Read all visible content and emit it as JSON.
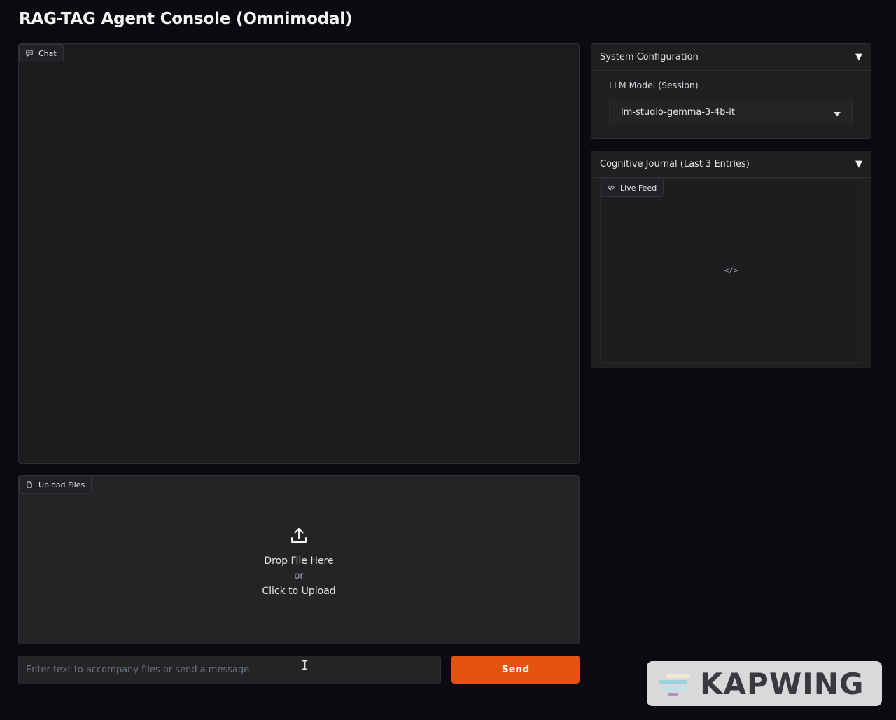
{
  "app": {
    "title": "RAG-TAG Agent Console (Omnimodal)"
  },
  "chat": {
    "label": "Chat",
    "icon": "chat-icon"
  },
  "upload": {
    "label": "Upload Files",
    "icon": "file-icon",
    "drop_text": "Drop File Here",
    "or_text": "- or -",
    "click_text": "Click to Upload",
    "upload_icon": "upload-icon"
  },
  "message": {
    "placeholder": "Enter text to accompany files or send a message",
    "value": ""
  },
  "send": {
    "label": "Send",
    "color": "#e4530f"
  },
  "system_config": {
    "title": "System Configuration",
    "caret": "▼",
    "llm_label": "LLM Model (Session)",
    "llm_value": "lm-studio-gemma-3-4b-it"
  },
  "journal": {
    "title": "Cognitive Journal (Last 3 Entries)",
    "caret": "▼",
    "feed_label": "Live Feed",
    "feed_icon": "code-icon",
    "empty_icon": "</>"
  },
  "watermark": {
    "text": "KAPWING"
  }
}
